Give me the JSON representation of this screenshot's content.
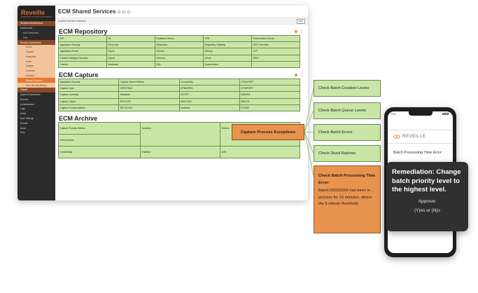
{
  "sidebar": {
    "logo": "Reveille",
    "logo_sub": "EFFECTIVE CONTENT MONITORING",
    "items": [
      {
        "label": "Reveille Administration",
        "cls": "hl"
      },
      {
        "label": "Dashboards",
        "cls": ""
      },
      {
        "label": "Add Dashboard",
        "cls": "sub"
      },
      {
        "label": "Files",
        "cls": "sub"
      },
      {
        "label": "Reveille Dashboards",
        "cls": "hl"
      },
      {
        "label": "ACEs",
        "cls": "sub2 lite"
      },
      {
        "label": "Capture",
        "cls": "sub2 lite"
      },
      {
        "label": "Enterprise",
        "cls": "sub2 lite"
      },
      {
        "label": "Kofax",
        "cls": "sub2 lite"
      },
      {
        "label": "Analytic",
        "cls": "sub2 lite"
      },
      {
        "label": "Common",
        "cls": "sub2 lite"
      },
      {
        "label": "Security",
        "cls": "sub2 lite"
      },
      {
        "label": "Shared Services",
        "cls": "sub2 active"
      },
      {
        "label": "Time Bar Monitoring",
        "cls": "sub2 lite"
      },
      {
        "label": "Tickets",
        "cls": "hl"
      },
      {
        "label": "System Dashboards",
        "cls": ""
      },
      {
        "label": "Reports",
        "cls": ""
      },
      {
        "label": "Administration",
        "cls": ""
      },
      {
        "label": "Logs",
        "cls": ""
      },
      {
        "label": "Alerts",
        "cls": ""
      },
      {
        "label": "User Settings",
        "cls": ""
      },
      {
        "label": "Results",
        "cls": ""
      },
      {
        "label": "About",
        "cls": ""
      },
      {
        "label": "Help",
        "cls": ""
      }
    ]
  },
  "window": {
    "title": "ECM Shared Services",
    "subtitle": "Content Services Monitors",
    "button": "Hide"
  },
  "repository": {
    "title": "ECM Repository",
    "rows": [
      [
        "API",
        "D2",
        "Database Server",
        "DFS",
        "Documentum Server"
      ],
      [
        "Application Security",
        "iFind User",
        "Repository",
        "Repository Gateway",
        "REST Services"
      ],
      [
        "Application Server",
        "Export",
        "Servers",
        "Webtop",
        "xCP"
      ],
      [
        "Content Intelligent Services",
        "Import",
        "Services",
        "xPlore",
        "REST"
      ],
      [
        "Custom",
        "Interfaces",
        "SQL",
        "Documentum",
        ""
      ]
    ]
  },
  "capture": {
    "title": "ECM Capture",
    "rows": [
      [
        "Application Security",
        "Capture Server Metrics",
        "Connectivity",
        "CPEXPORT"
      ],
      [
        "Capture Input",
        "CPEXTRAC",
        "CPIMGPRO",
        "CPIMPORT"
      ],
      [
        "Capture Licensing",
        "Database",
        "IXCOPY",
        "IMAGEN"
      ],
      [
        "Capture Output",
        "DPCLSSP",
        "IMGCONV",
        "SBOCR"
      ],
      [
        "Capture Process Metrics",
        "DPCOLLEC",
        "localhost",
        "SYSAPI"
      ]
    ]
  },
  "archive": {
    "title": "ECM Archive",
    "col1": [
      "Capture Process Metrics",
      "Client Access",
      "Connectivity"
    ],
    "col2": [
      "localhost",
      "Platform"
    ],
    "col3": [
      "Metrics",
      "sDB"
    ]
  },
  "exceptions_label": "Capture Process Exceptions",
  "checks": [
    "Check Batch Creation Levels",
    "Check Batch Queue Levels",
    "Check Batch Errors",
    "Check Stuck Batches"
  ],
  "error_box": {
    "heading": "Check Batch Processing Time Error:",
    "body": "Batch100200300 has been in process for 15 minutes, above the 5 minute threshold."
  },
  "phone": {
    "time": "9:41",
    "logo": "REVEILLE",
    "message": "Batch Processing Time Error:"
  },
  "popup": {
    "remediation": "Remediation: Change batch priority level to the highest level.",
    "approve": "Approve:",
    "choice": "(Y)es or (N)o"
  },
  "colors": {
    "accent": "#e8772e",
    "tile": "#c9e6a6",
    "exception": "#e8934e"
  }
}
